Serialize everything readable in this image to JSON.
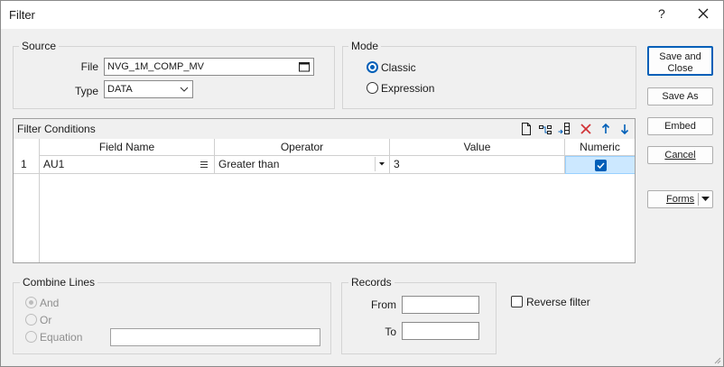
{
  "window": {
    "title": "Filter",
    "help_label": "?"
  },
  "source": {
    "group_label": "Source",
    "file_label": "File",
    "file_value": "NVG_1M_COMP_MV",
    "type_label": "Type",
    "type_value": "DATA"
  },
  "mode": {
    "group_label": "Mode",
    "classic_label": "Classic",
    "expression_label": "Expression",
    "selected": "Classic"
  },
  "buttons": {
    "save_close_line1": "Save and",
    "save_close_line2": "Close",
    "save_as": "Save As",
    "embed": "Embed",
    "cancel": "Cancel",
    "forms": "Forms"
  },
  "filter_conditions": {
    "title": "Filter Conditions",
    "columns": [
      "Field Name",
      "Operator",
      "Value",
      "Numeric"
    ],
    "rows": [
      {
        "row_num": "1",
        "field": "AU1",
        "operator": "Greater than",
        "value": "3",
        "numeric": true
      }
    ]
  },
  "combine_lines": {
    "group_label": "Combine Lines",
    "and_label": "And",
    "or_label": "Or",
    "equation_label": "Equation",
    "equation_value": ""
  },
  "records": {
    "group_label": "Records",
    "from_label": "From",
    "to_label": "To",
    "from_value": "",
    "to_value": ""
  },
  "reverse_filter_label": "Reverse filter"
}
